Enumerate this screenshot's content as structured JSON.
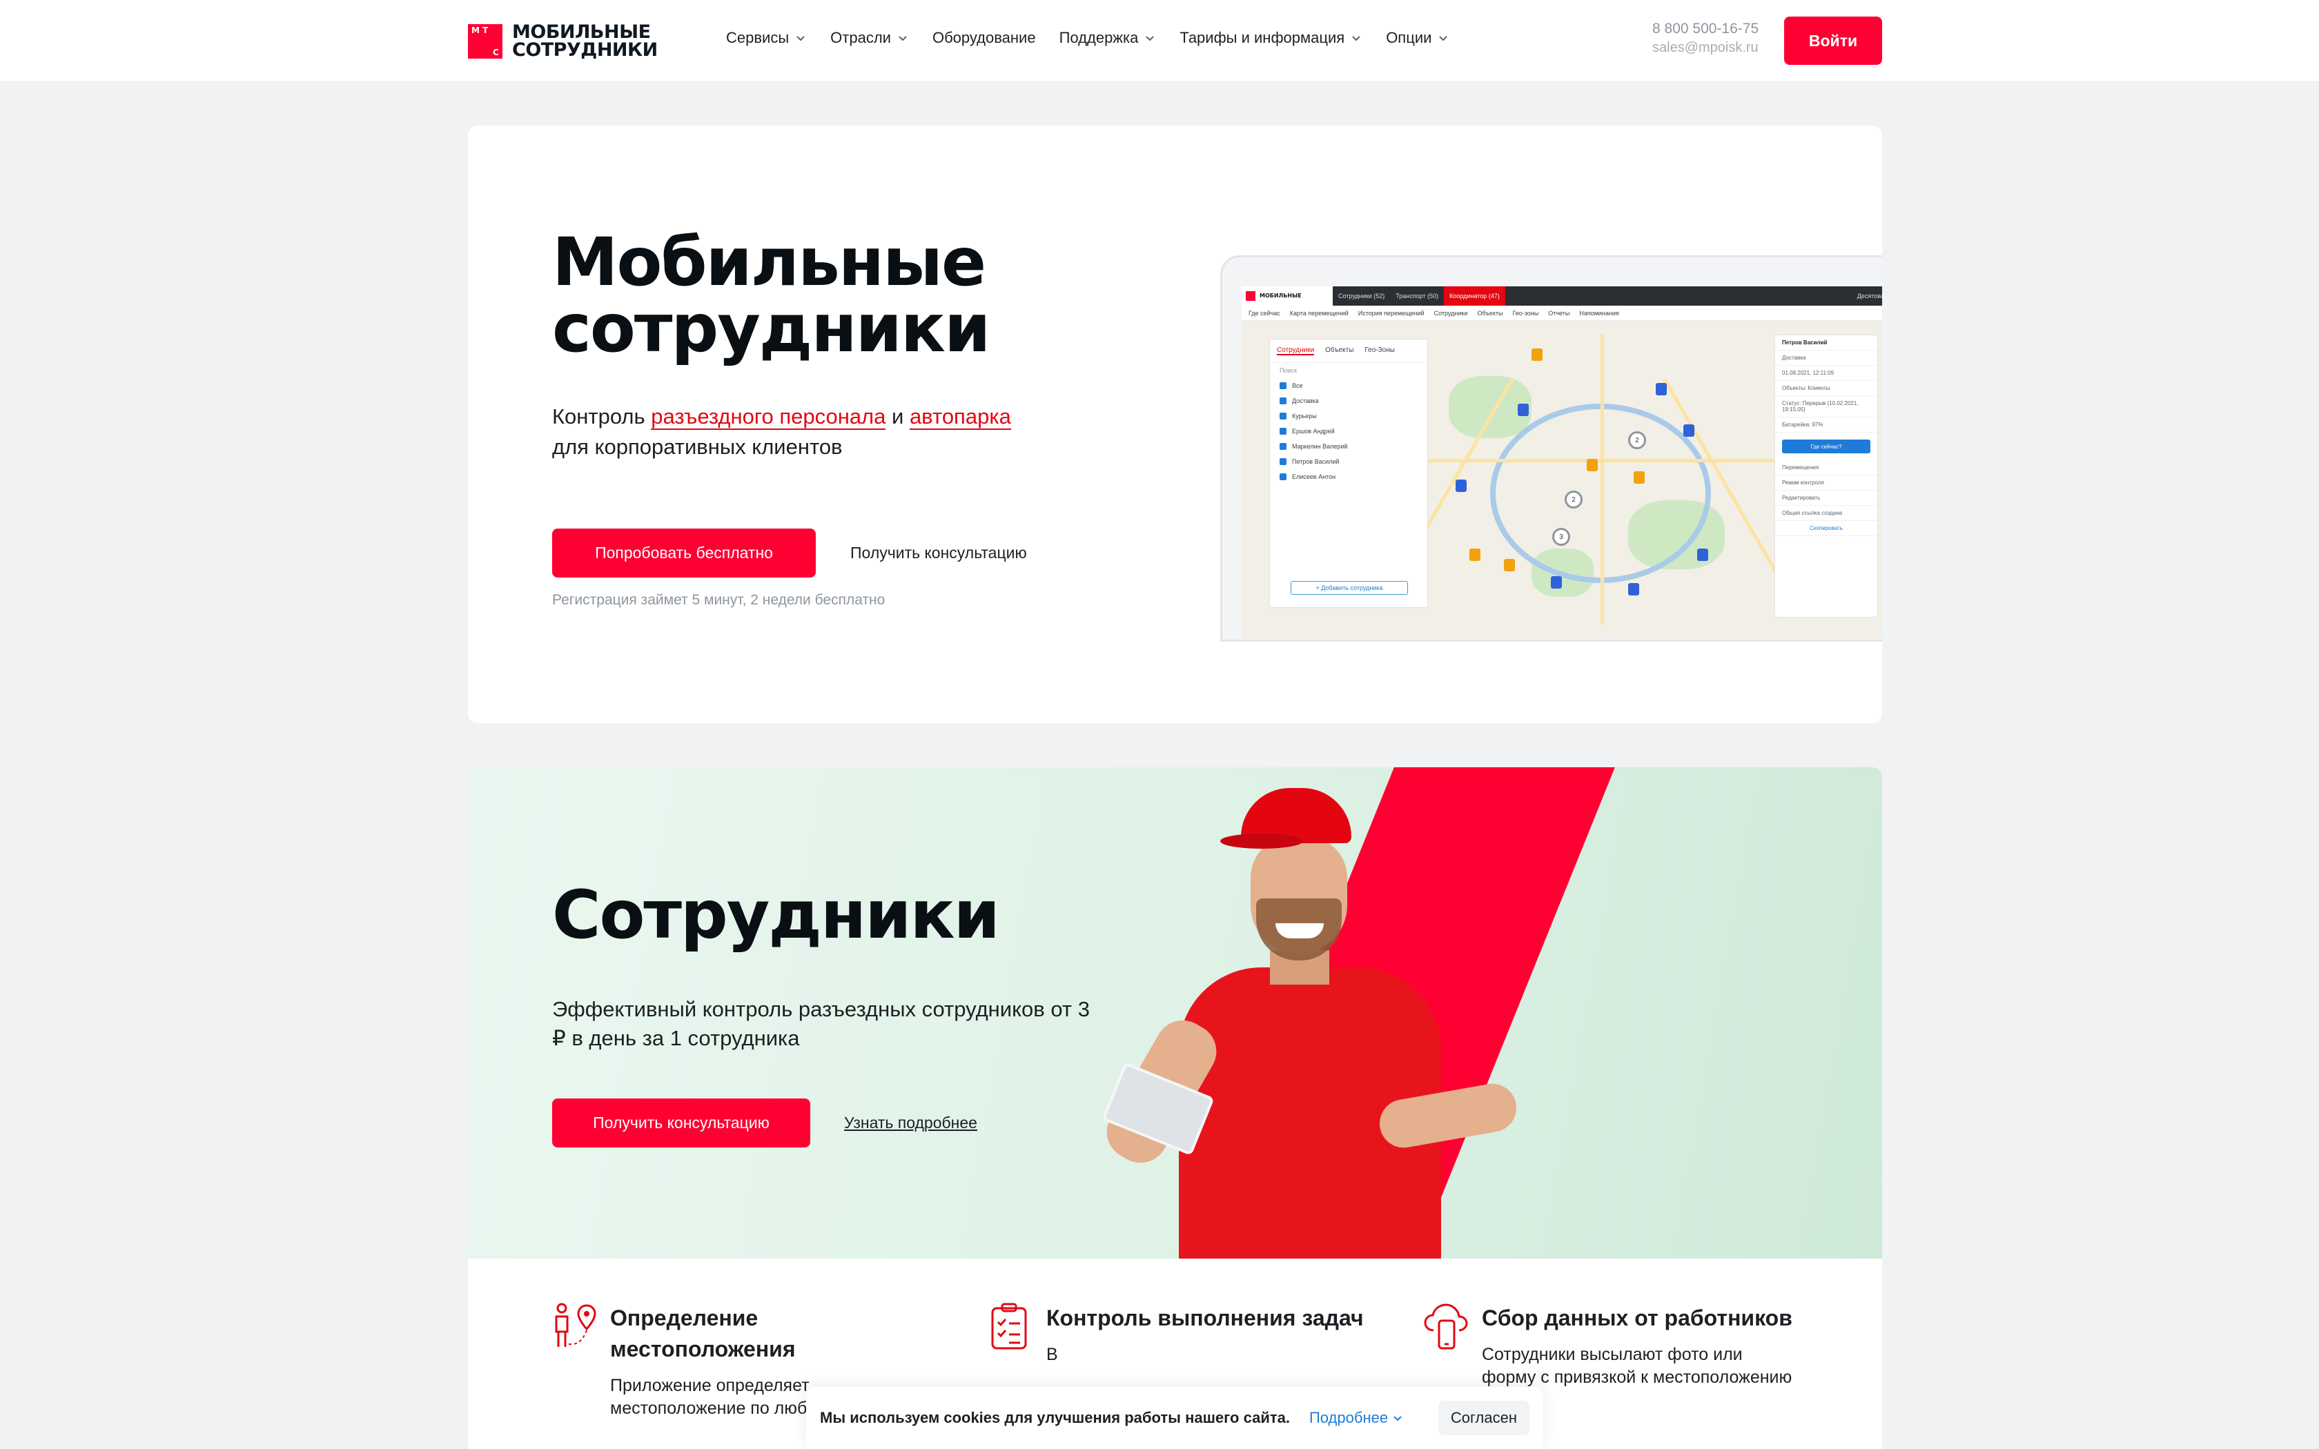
{
  "header": {
    "logo_top": "МОБИЛЬНЫЕ",
    "logo_bottom": "СОТРУДНИКИ",
    "logo_letters": [
      "М",
      "Т",
      "С"
    ],
    "nav": [
      {
        "label": "Сервисы",
        "dropdown": true
      },
      {
        "label": "Отрасли",
        "dropdown": true
      },
      {
        "label": "Оборудование",
        "dropdown": false
      },
      {
        "label": "Поддержка",
        "dropdown": true
      },
      {
        "label": "Тарифы и информация",
        "dropdown": true
      },
      {
        "label": "Опции",
        "dropdown": true
      }
    ],
    "phone": "8 800 500-16-75",
    "email": "sales@mpoisk.ru",
    "login_label": "Войти"
  },
  "hero": {
    "title_line1": "Мобильные",
    "title_line2": "сотрудники",
    "subtitle_prefix": "Контроль ",
    "subtitle_link1": "разъездного персонала",
    "subtitle_and": " и ",
    "subtitle_link2": "автопарка",
    "subtitle_line2": "для корпоративных клиентов",
    "try_label": "Попробовать бесплатно",
    "consult_label": "Получить консультацию",
    "note": "Регистрация займет 5 минут, 2 недели бесплатно"
  },
  "app_preview": {
    "tabs": [
      "Сотрудники (52)",
      "Транспорт (50)",
      "Координатор (47)"
    ],
    "user": "Десятова Марина",
    "menu": [
      "Где сейчас",
      "Карта перемещений",
      "История перемещений",
      "Сотрудники",
      "Объекты",
      "Гео-зоны",
      "Отчеты",
      "Напоминания"
    ],
    "panel_tabs": [
      "Сотрудники",
      "Объекты",
      "Гео-Зоны"
    ],
    "search_placeholder": "Поиск",
    "rows": [
      "Все",
      "Доставка",
      "Курьеры",
      "Ершов Андрей",
      "Маркелин Валерий",
      "Петров Василий",
      "Елисеев Антон"
    ],
    "add_label": "+ Добавить сотрудника",
    "right_name": "Петров Василий",
    "right_lines": [
      "Доставка",
      "01.08.2021, 12:11:09",
      "Объекты: Клиенты",
      "Статус: Перерыв (10.02.2021, 19:15:05)",
      "Батарейка: 97%"
    ],
    "right_button": "Где сейчас?",
    "right_actions": [
      "Перемещения",
      "Режим контроля",
      "Редактировать",
      "Общая ссылка создана",
      "Скопировать"
    ]
  },
  "employees": {
    "title": "Сотрудники",
    "subtitle": "Эффективный контроль разъездных сотрудников от 3 ₽ в день за 1 сотрудника",
    "consult_label": "Получить консультацию",
    "more_label": "Узнать подробнее"
  },
  "features": [
    {
      "icon": "location-person-icon",
      "title": "Определение местоположения",
      "desc": "Приложение определяет местоположение по любым телефонам"
    },
    {
      "icon": "task-checklist-icon",
      "title": "Контроль выполнения задач",
      "desc": "В"
    },
    {
      "icon": "cloud-phone-icon",
      "title": "Сбор данных от работников",
      "desc": "Сотрудники высылают фото или форму с привязкой к местоположению"
    }
  ],
  "cookie": {
    "text": "Мы используем cookies для улучшения работы нашего сайта.",
    "more_label": "Подробнее",
    "accept_label": "Согласен"
  },
  "colors": {
    "brand_red": "#ff0032",
    "link_blue": "#1f7bd8",
    "text": "#1d2023",
    "muted": "#8d969f"
  }
}
